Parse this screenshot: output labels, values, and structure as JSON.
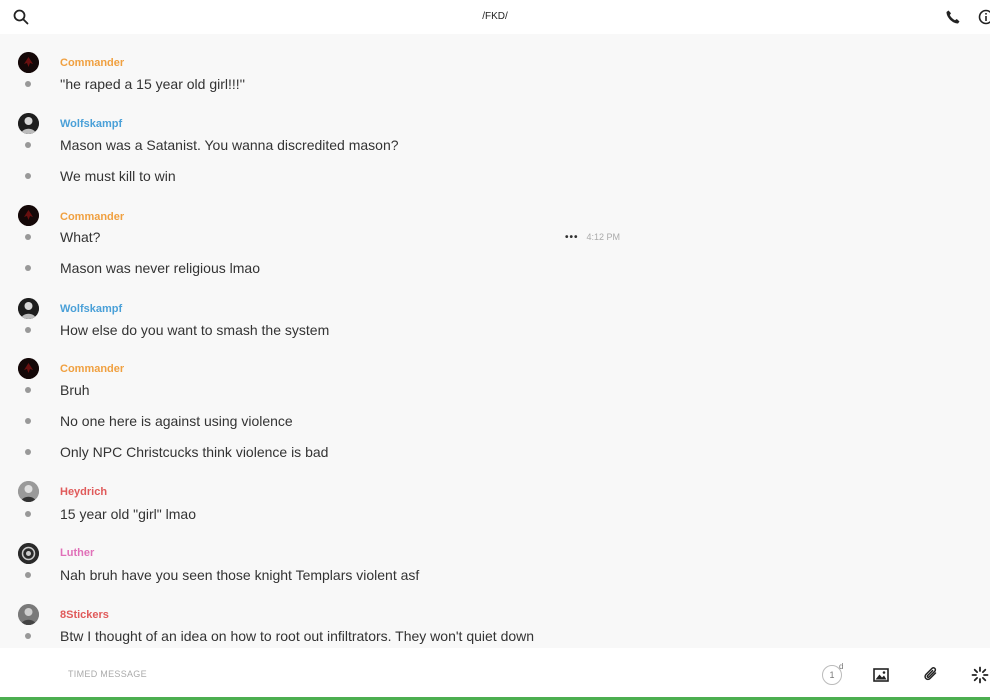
{
  "header": {
    "title": "/FKD/",
    "icons": [
      "search-icon",
      "phone-icon",
      "info-icon"
    ]
  },
  "colors": {
    "Commander": "#f0a040",
    "Wolfskampf": "#4aa0d8",
    "Heydrich": "#e05a5a",
    "Luther": "#e070b8",
    "8Stickers": "#e05a5a"
  },
  "messages": [
    {
      "sender": "Commander",
      "text": "''he raped a 15 year old girl!!!''"
    },
    {
      "sender": "Wolfskampf",
      "text": "Mason was a Satanist. You wanna discredited mason?"
    },
    {
      "sender": "",
      "text": "We must kill to win"
    },
    {
      "sender": "Commander",
      "text": "What?"
    },
    {
      "sender": "",
      "text": "Mason was never religious lmao"
    },
    {
      "sender": "Wolfskampf",
      "text": "How else do you want to smash the system"
    },
    {
      "sender": "Commander",
      "text": "Bruh"
    },
    {
      "sender": "",
      "text": "No one here is against using violence"
    },
    {
      "sender": "",
      "text": "Only NPC Christcucks think violence is bad"
    },
    {
      "sender": "Heydrich",
      "text": "15 year old \"girl\" lmao"
    },
    {
      "sender": "Luther",
      "text": "Nah bruh have you seen those knight Templars violent asf"
    },
    {
      "sender": "8Stickers",
      "text": "Btw I thought of an idea on how to root out infiltrators. They won't quiet down"
    }
  ],
  "hover": {
    "more_label": "•••",
    "time": "4:12 PM"
  },
  "composer": {
    "placeholder": "TIMED MESSAGE",
    "timer_value": "1",
    "timer_unit": "d",
    "icons": [
      "timer-icon",
      "image-icon",
      "attachment-icon",
      "loading-icon"
    ]
  }
}
